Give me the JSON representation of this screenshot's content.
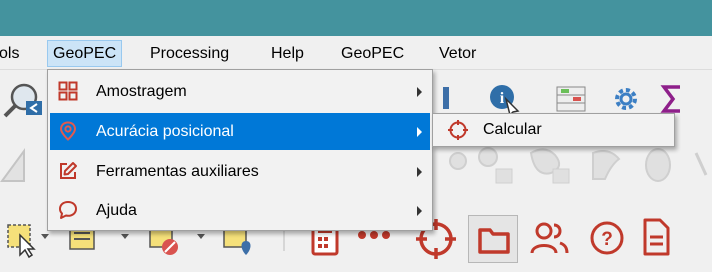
{
  "menubar": {
    "items": [
      {
        "label": "ols"
      },
      {
        "label": "GeoPEC"
      },
      {
        "label": "Processing"
      },
      {
        "label": "Help"
      },
      {
        "label": "GeoPEC"
      },
      {
        "label": "Vetor"
      }
    ]
  },
  "dropdown": {
    "items": [
      {
        "label": "Amostragem",
        "icon": "grid-icon"
      },
      {
        "label": "Acurácia posicional",
        "icon": "map-pin-icon"
      },
      {
        "label": "Ferramentas auxiliares",
        "icon": "edit-icon"
      },
      {
        "label": "Ajuda",
        "icon": "speech-bubble-icon"
      }
    ]
  },
  "submenu": {
    "items": [
      {
        "label": "Calcular",
        "icon": "crosshair-icon"
      }
    ]
  },
  "colors": {
    "titlebar": "#44939e",
    "highlight": "#0078d7",
    "accent_red": "#c0392b"
  }
}
